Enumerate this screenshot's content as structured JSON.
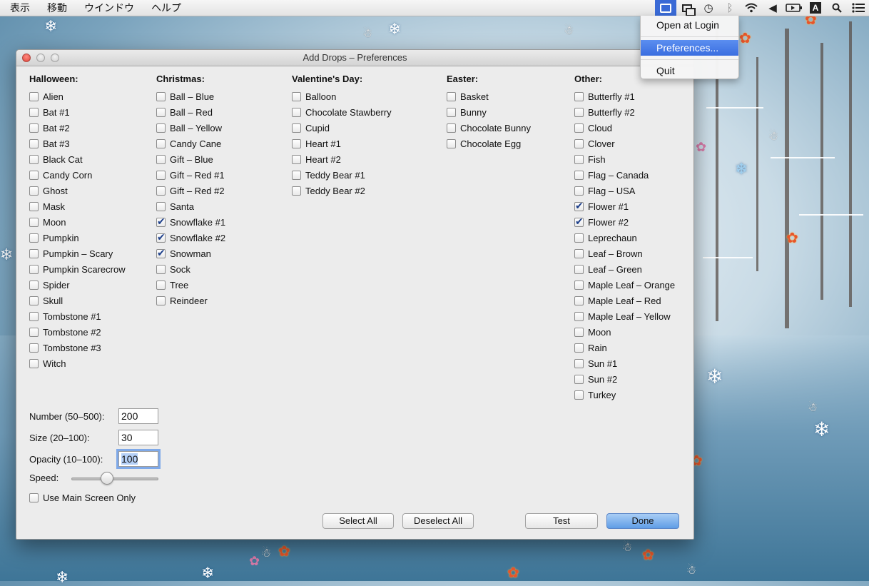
{
  "menubar": {
    "items": [
      "表示",
      "移動",
      "ウインドウ",
      "ヘルプ"
    ],
    "status_icons": [
      "add-drops-icon",
      "display-mirroring-icon",
      "time-machine-icon",
      "bluetooth-icon",
      "wifi-icon",
      "volume-icon",
      "battery-icon",
      "input-method-icon",
      "spotlight-icon",
      "notification-center-icon"
    ],
    "input_method_letter": "A"
  },
  "dropdown": {
    "items": [
      "Open at Login",
      "Preferences...",
      "Quit"
    ],
    "selected": "Preferences..."
  },
  "window": {
    "title": "Add Drops – Preferences"
  },
  "categories": [
    {
      "name": "Halloween:",
      "items": [
        {
          "label": "Alien",
          "checked": false
        },
        {
          "label": "Bat #1",
          "checked": false
        },
        {
          "label": "Bat #2",
          "checked": false
        },
        {
          "label": "Bat #3",
          "checked": false
        },
        {
          "label": "Black Cat",
          "checked": false
        },
        {
          "label": "Candy Corn",
          "checked": false
        },
        {
          "label": "Ghost",
          "checked": false
        },
        {
          "label": "Mask",
          "checked": false
        },
        {
          "label": "Moon",
          "checked": false
        },
        {
          "label": "Pumpkin",
          "checked": false
        },
        {
          "label": "Pumpkin – Scary",
          "checked": false
        },
        {
          "label": "Pumpkin Scarecrow",
          "checked": false
        },
        {
          "label": "Spider",
          "checked": false
        },
        {
          "label": "Skull",
          "checked": false
        },
        {
          "label": "Tombstone #1",
          "checked": false
        },
        {
          "label": "Tombstone #2",
          "checked": false
        },
        {
          "label": "Tombstone #3",
          "checked": false
        },
        {
          "label": "Witch",
          "checked": false
        }
      ]
    },
    {
      "name": "Christmas:",
      "items": [
        {
          "label": "Ball – Blue",
          "checked": false
        },
        {
          "label": "Ball – Red",
          "checked": false
        },
        {
          "label": "Ball – Yellow",
          "checked": false
        },
        {
          "label": "Candy Cane",
          "checked": false
        },
        {
          "label": "Gift – Blue",
          "checked": false
        },
        {
          "label": "Gift – Red #1",
          "checked": false
        },
        {
          "label": "Gift – Red #2",
          "checked": false
        },
        {
          "label": "Santa",
          "checked": false
        },
        {
          "label": "Snowflake #1",
          "checked": true
        },
        {
          "label": "Snowflake #2",
          "checked": true
        },
        {
          "label": "Snowman",
          "checked": true
        },
        {
          "label": "Sock",
          "checked": false
        },
        {
          "label": "Tree",
          "checked": false
        },
        {
          "label": "Reindeer",
          "checked": false
        }
      ]
    },
    {
      "name": "Valentine's Day:",
      "items": [
        {
          "label": "Balloon",
          "checked": false
        },
        {
          "label": "Chocolate Stawberry",
          "checked": false
        },
        {
          "label": "Cupid",
          "checked": false
        },
        {
          "label": "Heart #1",
          "checked": false
        },
        {
          "label": "Heart #2",
          "checked": false
        },
        {
          "label": "Teddy Bear #1",
          "checked": false
        },
        {
          "label": "Teddy Bear #2",
          "checked": false
        }
      ]
    },
    {
      "name": "Easter:",
      "items": [
        {
          "label": "Basket",
          "checked": false
        },
        {
          "label": "Bunny",
          "checked": false
        },
        {
          "label": "Chocolate  Bunny",
          "checked": false
        },
        {
          "label": "Chocolate  Egg",
          "checked": false
        }
      ]
    },
    {
      "name": "Other:",
      "items": [
        {
          "label": "Butterfly #1",
          "checked": false
        },
        {
          "label": "Butterfly #2",
          "checked": false
        },
        {
          "label": "Cloud",
          "checked": false
        },
        {
          "label": "Clover",
          "checked": false
        },
        {
          "label": "Fish",
          "checked": false
        },
        {
          "label": "Flag – Canada",
          "checked": false
        },
        {
          "label": "Flag – USA",
          "checked": false
        },
        {
          "label": "Flower #1",
          "checked": true
        },
        {
          "label": "Flower #2",
          "checked": true
        },
        {
          "label": "Leprechaun",
          "checked": false
        },
        {
          "label": "Leaf – Brown",
          "checked": false
        },
        {
          "label": "Leaf – Green",
          "checked": false
        },
        {
          "label": "Maple Leaf – Orange",
          "checked": false
        },
        {
          "label": "Maple Leaf – Red",
          "checked": false
        },
        {
          "label": "Maple Leaf – Yellow",
          "checked": false
        },
        {
          "label": "Moon",
          "checked": false
        },
        {
          "label": "Rain",
          "checked": false
        },
        {
          "label": "Sun #1",
          "checked": false
        },
        {
          "label": "Sun #2",
          "checked": false
        },
        {
          "label": "Turkey",
          "checked": false
        }
      ]
    }
  ],
  "settings": {
    "number_label": "Number (50–500):",
    "number_value": "200",
    "size_label": "Size (20–100):",
    "size_value": "30",
    "opacity_label": "Opacity (10–100):",
    "opacity_value": "100",
    "speed_label": "Speed:",
    "speed_fraction": 0.38,
    "main_screen_label": "Use Main Screen Only",
    "main_screen_checked": false
  },
  "buttons": {
    "select_all": "Select All",
    "deselect_all": "Deselect All",
    "test": "Test",
    "done": "Done"
  },
  "colors": {
    "accent": "#3a6ee0",
    "checkmark": "#1d3f8a",
    "default_button": "#5f9de6"
  }
}
